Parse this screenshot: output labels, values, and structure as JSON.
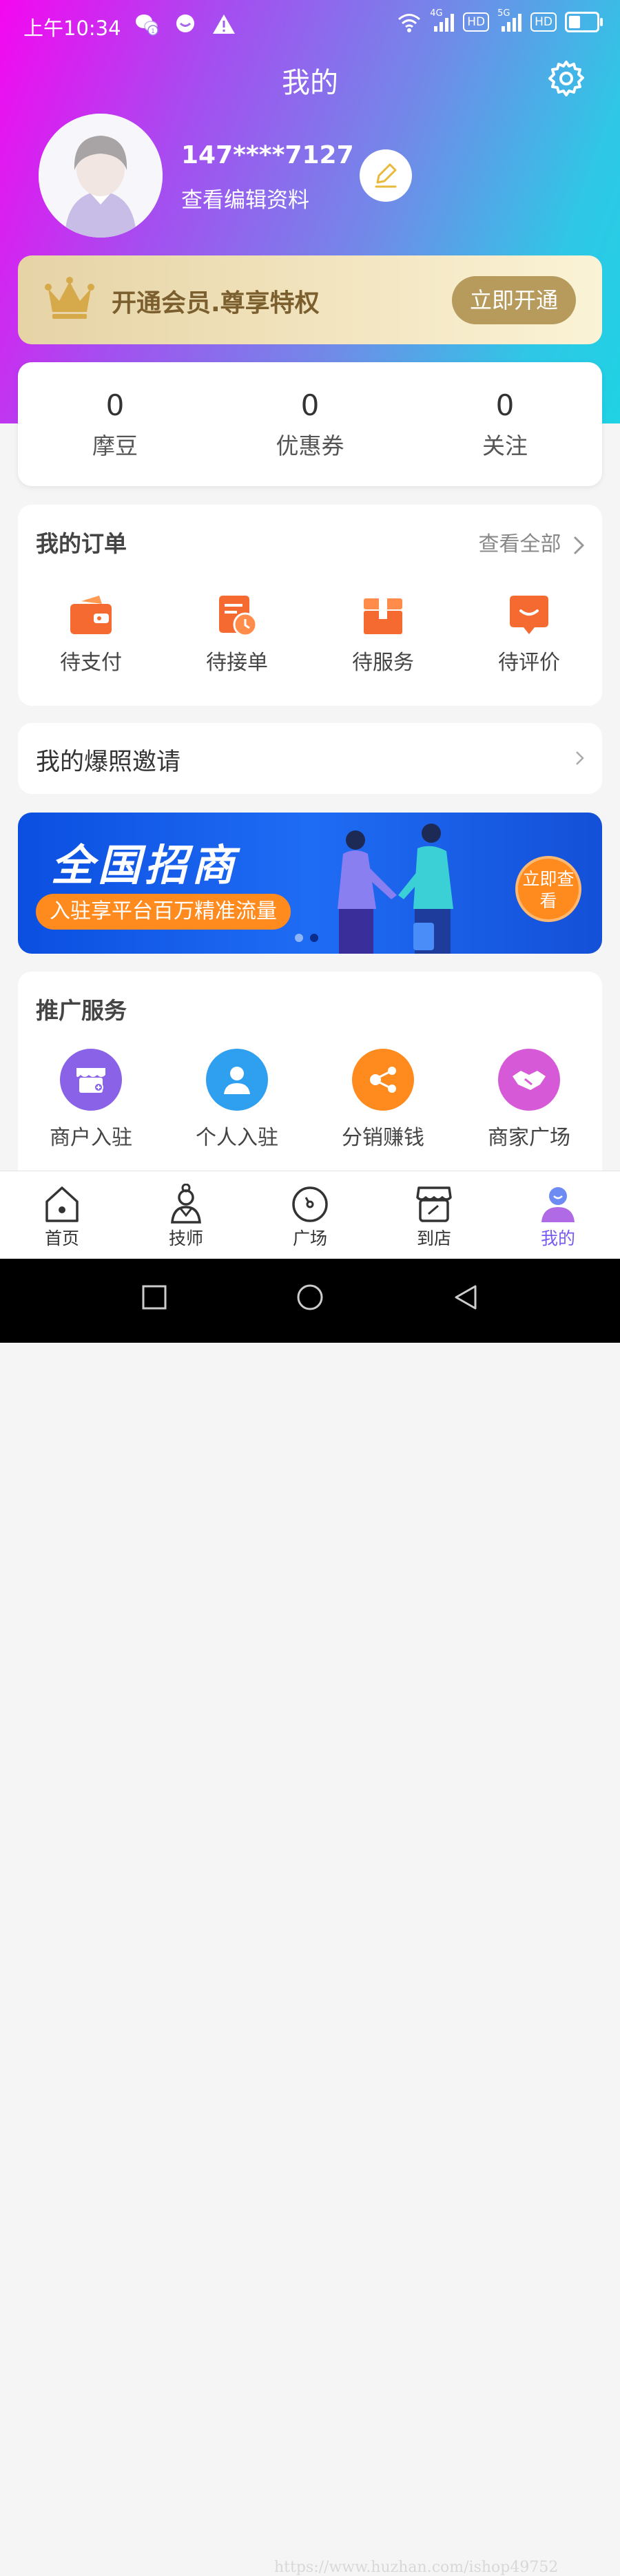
{
  "status_bar": {
    "time": "上午10:34",
    "network_1": "4G",
    "hd_1": "HD",
    "network_2": "5G",
    "hd_2": "HD",
    "icons": [
      "wechat-icon",
      "message-icon",
      "warning-icon",
      "wifi-icon",
      "signal-icon",
      "battery-icon"
    ]
  },
  "header": {
    "title": "我的"
  },
  "profile": {
    "username": "147****7127",
    "edit_link": "查看编辑资料"
  },
  "vip": {
    "text": "开通会员.尊享特权",
    "button": "立即开通"
  },
  "stats": [
    {
      "value": "0",
      "label": "摩豆"
    },
    {
      "value": "0",
      "label": "优惠券"
    },
    {
      "value": "0",
      "label": "关注"
    }
  ],
  "orders": {
    "title": "我的订单",
    "see_all": "查看全部",
    "items": [
      {
        "label": "待支付",
        "icon": "wallet-icon"
      },
      {
        "label": "待接单",
        "icon": "order-clock-icon"
      },
      {
        "label": "待服务",
        "icon": "box-icon"
      },
      {
        "label": "待评价",
        "icon": "comment-icon"
      }
    ]
  },
  "invite": {
    "label": "我的爆照邀请"
  },
  "banner": {
    "title": "全国招商",
    "subtitle": "入驻享平台百万精准流量",
    "button": "立即查看",
    "slide_count": 2,
    "active_slide": 2
  },
  "promo": {
    "title": "推广服务",
    "items": [
      {
        "label": "商户入驻",
        "icon": "store-icon",
        "color": "#8a62e8"
      },
      {
        "label": "个人入驻",
        "icon": "person-icon",
        "color": "#2f9ff0"
      },
      {
        "label": "分销赚钱",
        "icon": "share-icon",
        "color": "#ff8a1e"
      },
      {
        "label": "商家广场",
        "icon": "handshake-icon",
        "color": "#d65ad8"
      }
    ]
  },
  "tabbar": [
    {
      "label": "首页",
      "icon": "home-icon"
    },
    {
      "label": "技师",
      "icon": "technician-icon"
    },
    {
      "label": "广场",
      "icon": "plaza-icon"
    },
    {
      "label": "到店",
      "icon": "shop-icon"
    },
    {
      "label": "我的",
      "icon": "me-icon",
      "active": true
    }
  ],
  "watermark": "https://www.huzhan.com/ishop49752",
  "colors": {
    "accent": "#7a5af0",
    "vip_gold": "#b79b5d",
    "banner_blue": "#1f6cf4",
    "orange": "#ff8a1e"
  }
}
